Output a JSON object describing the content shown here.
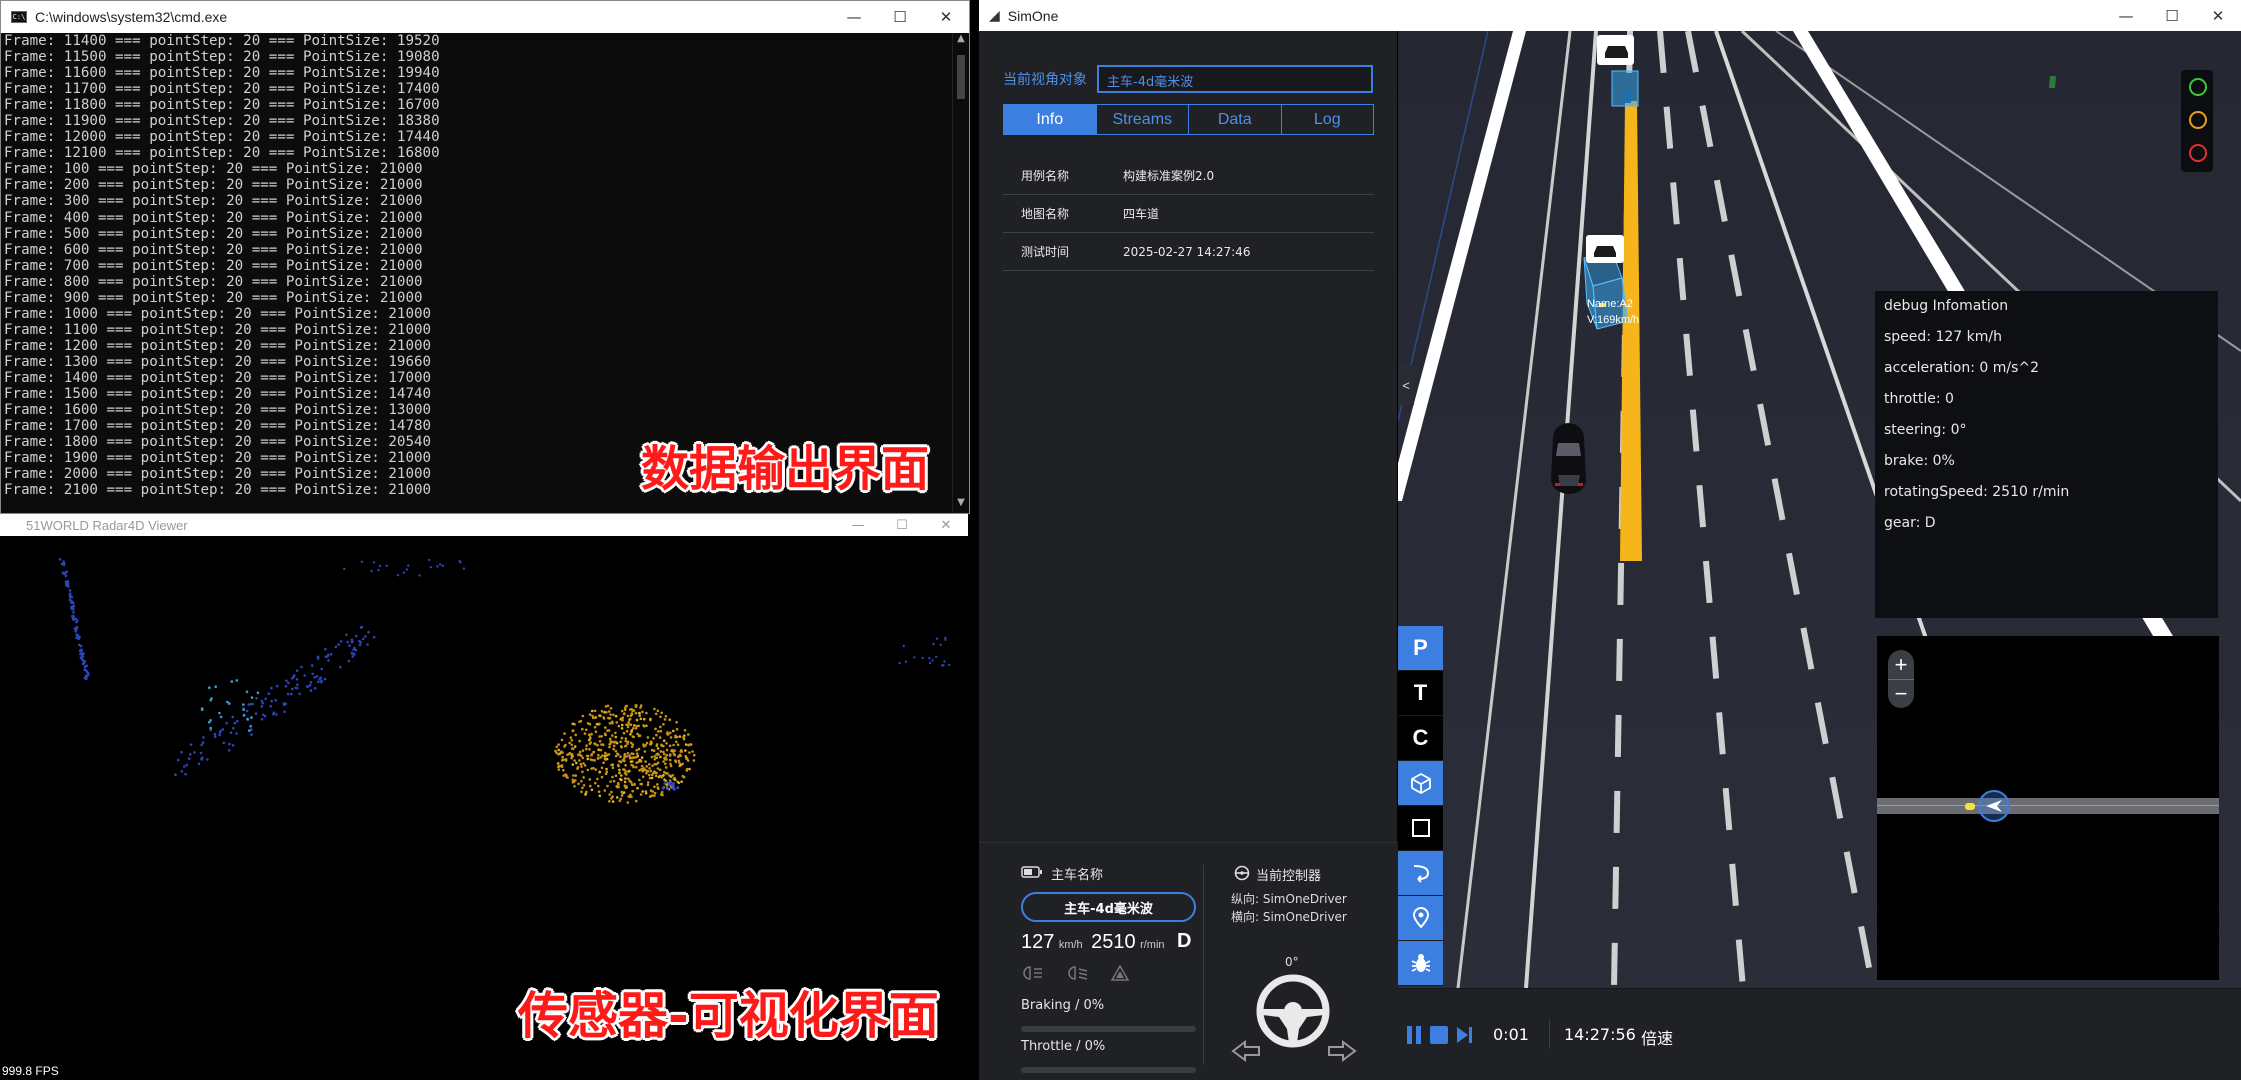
{
  "cmd": {
    "title": "C:\\windows\\system32\\cmd.exe",
    "lines": [
      "Frame: 11400 === pointStep: 20 === PointSize: 19520",
      "Frame: 11500 === pointStep: 20 === PointSize: 19080",
      "Frame: 11600 === pointStep: 20 === PointSize: 19940",
      "Frame: 11700 === pointStep: 20 === PointSize: 17400",
      "Frame: 11800 === pointStep: 20 === PointSize: 16700",
      "Frame: 11900 === pointStep: 20 === PointSize: 18380",
      "Frame: 12000 === pointStep: 20 === PointSize: 17440",
      "Frame: 12100 === pointStep: 20 === PointSize: 16800",
      "Frame: 100 === pointStep: 20 === PointSize: 21000",
      "Frame: 200 === pointStep: 20 === PointSize: 21000",
      "Frame: 300 === pointStep: 20 === PointSize: 21000",
      "Frame: 400 === pointStep: 20 === PointSize: 21000",
      "Frame: 500 === pointStep: 20 === PointSize: 21000",
      "Frame: 600 === pointStep: 20 === PointSize: 21000",
      "Frame: 700 === pointStep: 20 === PointSize: 21000",
      "Frame: 800 === pointStep: 20 === PointSize: 21000",
      "Frame: 900 === pointStep: 20 === PointSize: 21000",
      "Frame: 1000 === pointStep: 20 === PointSize: 21000",
      "Frame: 1100 === pointStep: 20 === PointSize: 21000",
      "Frame: 1200 === pointStep: 20 === PointSize: 21000",
      "Frame: 1300 === pointStep: 20 === PointSize: 19660",
      "Frame: 1400 === pointStep: 20 === PointSize: 17000",
      "Frame: 1500 === pointStep: 20 === PointSize: 14740",
      "Frame: 1600 === pointStep: 20 === PointSize: 13000",
      "Frame: 1700 === pointStep: 20 === PointSize: 14780",
      "Frame: 1800 === pointStep: 20 === PointSize: 20540",
      "Frame: 1900 === pointStep: 20 === PointSize: 21000",
      "Frame: 2000 === pointStep: 20 === PointSize: 21000",
      "Frame: 2100 === pointStep: 20 === PointSize: 21000"
    ],
    "overlay_label": "数据输出界面"
  },
  "radar": {
    "title": "51WORLD Radar4D Viewer",
    "fps": "999.8 FPS",
    "overlay_label": "传感器-可视化界面"
  },
  "window_buttons": {
    "minimize": "—",
    "maximize": "☐",
    "close": "✕"
  },
  "simone": {
    "title": "SimOne",
    "view_target_label": "当前视角对象",
    "view_target_value": "主车-4d毫米波",
    "tabs": [
      {
        "label": "Info",
        "active": true
      },
      {
        "label": "Streams",
        "active": false
      },
      {
        "label": "Data",
        "active": false
      },
      {
        "label": "Log",
        "active": false
      }
    ],
    "info": [
      {
        "key": "用例名称",
        "value": "构建标准案例2.0"
      },
      {
        "key": "地图名称",
        "value": "四车道"
      },
      {
        "key": "测试时间",
        "value": "2025-02-27 14:27:46"
      }
    ],
    "vehicle": {
      "name_label": "主车名称",
      "name_value": "主车-4d毫米波",
      "speed": "127",
      "speed_unit": "km/h",
      "rpm": "2510",
      "rpm_unit": "r/min",
      "gear": "D",
      "braking_label": "Braking / 0%",
      "braking": 0,
      "throttle_label": "Throttle / 0%",
      "throttle": 0
    },
    "controller": {
      "title": "当前控制器",
      "longitudinal": "纵向:  SimOneDriver",
      "lateral": "横向:  SimOneDriver",
      "steering_angle": "0°"
    },
    "scene": {
      "npc_label_name": "Name:A2",
      "npc_label_speed": "V:169km/h"
    },
    "toolbar": [
      "P",
      "T",
      "C",
      "cube-icon",
      "square-icon",
      "route-icon",
      "location-icon",
      "bug-icon"
    ],
    "collapse": "<",
    "debug": {
      "title": "debug Infomation",
      "speed": "speed: 127 km/h",
      "acceleration": "acceleration: 0 m/s^2",
      "throttle": "throttle: 0",
      "steering": "steering: 0°",
      "brake": "brake: 0%",
      "rotating": "rotatingSpeed: 2510 r/min",
      "gear": "gear: D"
    },
    "minimap": {
      "zoom_in": "+",
      "zoom_out": "−"
    },
    "traffic_light_colors": [
      "#3ac93a",
      "#e8a020",
      "#e23030"
    ],
    "playback": {
      "elapsed": "0:01",
      "clock": "14:27:56",
      "speed_label": "倍速"
    },
    "colors": {
      "accent": "#3d7fe0",
      "lane_yellow": "#f6b51a",
      "npc_box": "#36a6ee"
    }
  }
}
